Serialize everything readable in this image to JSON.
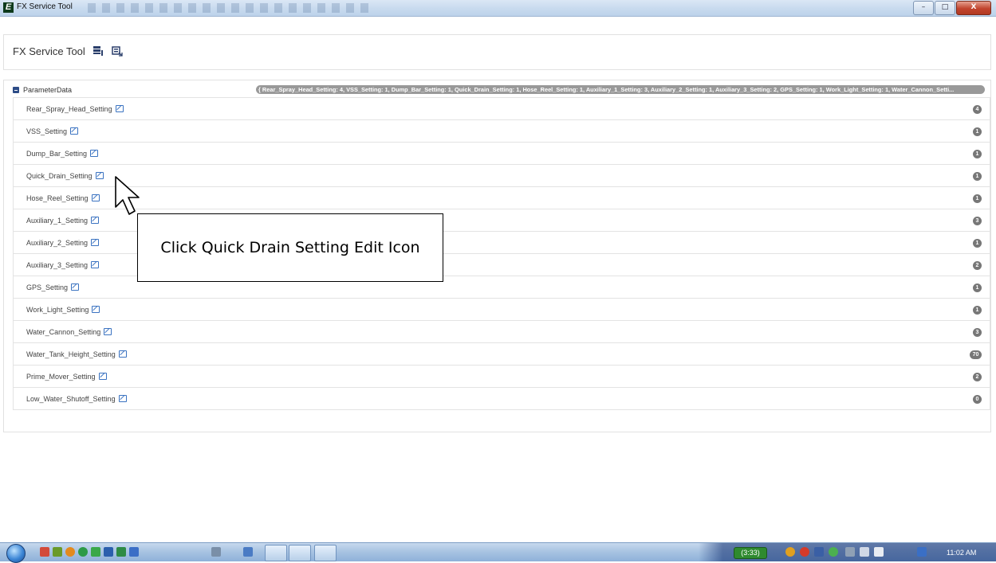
{
  "window": {
    "title": "FX Service Tool",
    "controls": {
      "minimize": "–",
      "maximize": "□",
      "close": "X"
    }
  },
  "header": {
    "app_name": "FX Service Tool",
    "toolbar_icons": [
      "connect-icon",
      "refresh-data-icon"
    ]
  },
  "tree": {
    "root_label": "ParameterData",
    "root_summary": "{ Rear_Spray_Head_Setting: 4, VSS_Setting: 1, Dump_Bar_Setting: 1, Quick_Drain_Setting: 1, Hose_Reel_Setting: 1, Auxiliary_1_Setting: 3, Auxiliary_2_Setting: 1, Auxiliary_3_Setting: 2, GPS_Setting: 1, Work_Light_Setting: 1, Water_Cannon_Setti...",
    "items": [
      {
        "label": "Rear_Spray_Head_Setting",
        "value": "4"
      },
      {
        "label": "VSS_Setting",
        "value": "1"
      },
      {
        "label": "Dump_Bar_Setting",
        "value": "1"
      },
      {
        "label": "Quick_Drain_Setting",
        "value": "1"
      },
      {
        "label": "Hose_Reel_Setting",
        "value": "1"
      },
      {
        "label": "Auxiliary_1_Setting",
        "value": "3"
      },
      {
        "label": "Auxiliary_2_Setting",
        "value": "1"
      },
      {
        "label": "Auxiliary_3_Setting",
        "value": "2"
      },
      {
        "label": "GPS_Setting",
        "value": "1"
      },
      {
        "label": "Work_Light_Setting",
        "value": "1"
      },
      {
        "label": "Water_Cannon_Setting",
        "value": "3"
      },
      {
        "label": "Water_Tank_Height_Setting",
        "value": "70"
      },
      {
        "label": "Prime_Mover_Setting",
        "value": "2"
      },
      {
        "label": "Low_Water_Shutoff_Setting",
        "value": "0"
      }
    ]
  },
  "callout": {
    "text": "Click Quick Drain Setting Edit Icon"
  },
  "taskbar": {
    "battery": "(3:33)",
    "clock": "11:02 AM"
  },
  "colors": {
    "edit_icon": "#3b73c1",
    "badge": "#777777",
    "summary_badge": "#999999",
    "collapse_icon": "#2d4c87"
  }
}
